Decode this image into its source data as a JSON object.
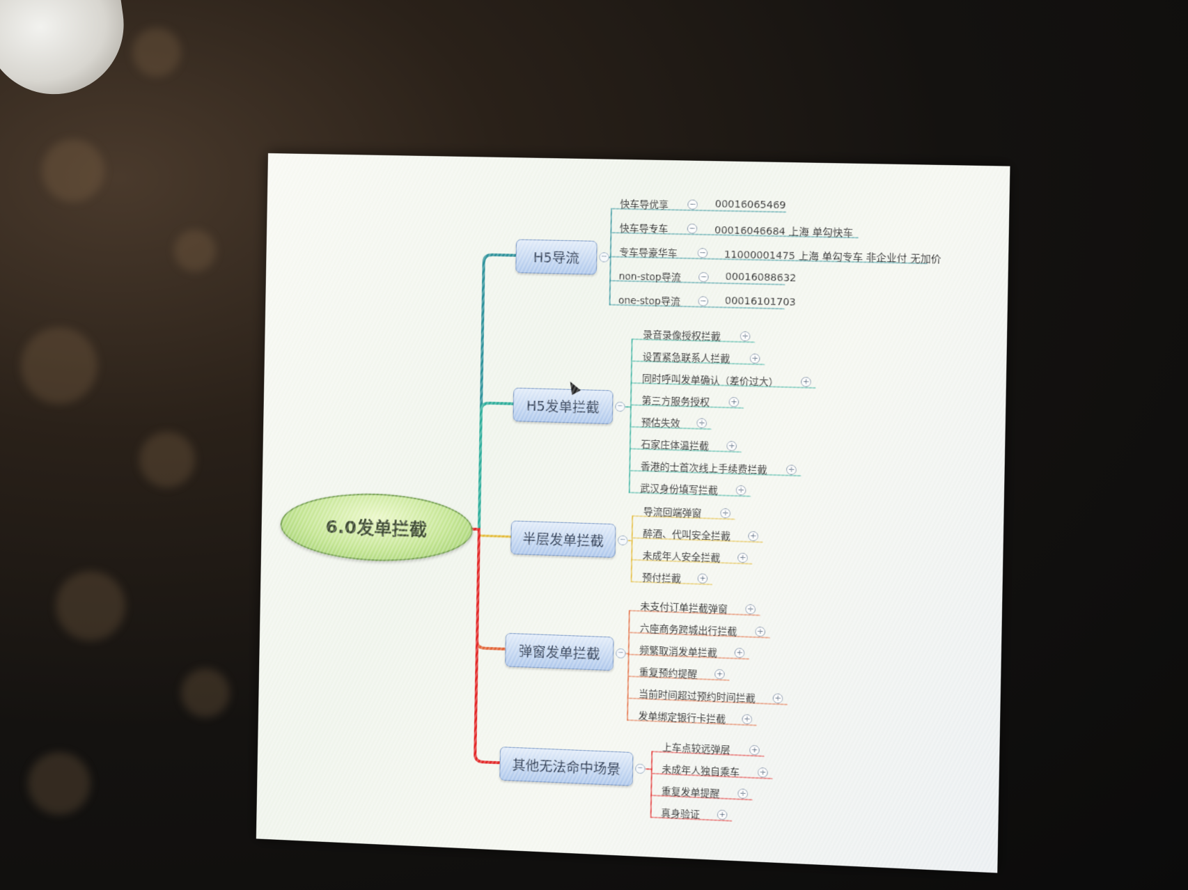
{
  "mindmap": {
    "root": "6.0发单拦截",
    "branches": [
      {
        "label": "H5导流",
        "items": [
          {
            "label": "快车导优享",
            "value": "00016065469"
          },
          {
            "label": "快车导专车",
            "value": "00016046684 上海 单勾快车"
          },
          {
            "label": "专车导豪华车",
            "value": "11000001475 上海 单勾专车 非企业付 无加价"
          },
          {
            "label": "non-stop导流",
            "value": "00016088632"
          },
          {
            "label": "one-stop导流",
            "value": "00016101703"
          }
        ]
      },
      {
        "label": "H5发单拦截",
        "items": [
          {
            "label": "录音录像授权拦截"
          },
          {
            "label": "设置紧急联系人拦截"
          },
          {
            "label": "同时呼叫发单确认（差价过大）"
          },
          {
            "label": "第三方服务授权"
          },
          {
            "label": "预估失效"
          },
          {
            "label": "石家庄体温拦截"
          },
          {
            "label": "香港的士首次线上手续费拦截"
          },
          {
            "label": "武汉身份填写拦截"
          }
        ]
      },
      {
        "label": "半层发单拦截",
        "items": [
          {
            "label": "导流回端弹窗"
          },
          {
            "label": "醉酒、代叫安全拦截"
          },
          {
            "label": "未成年人安全拦截"
          },
          {
            "label": "预付拦截"
          }
        ]
      },
      {
        "label": "弹窗发单拦截",
        "items": [
          {
            "label": "未支付订单拦截弹窗"
          },
          {
            "label": "六座商务跨城出行拦截"
          },
          {
            "label": "频繁取消发单拦截"
          },
          {
            "label": "重复预约提醒"
          },
          {
            "label": "当前时间超过预约时间拦截"
          },
          {
            "label": "发单绑定银行卡拦截"
          }
        ]
      },
      {
        "label": "其他无法命中场景",
        "items": [
          {
            "label": "上车点较远弹层"
          },
          {
            "label": "未成年人独自乘车"
          },
          {
            "label": "重复发单提醒"
          },
          {
            "label": "真身验证"
          }
        ]
      }
    ],
    "colors": {
      "branch1_line": "#1f8a93",
      "branch2_line": "#20a894",
      "branch3_line": "#e0b21e",
      "branch4_line": "#e05a2a",
      "branch5_line": "#e01818",
      "root_fill": "#bfe38a",
      "node_fill": "#a9c4ea"
    }
  }
}
